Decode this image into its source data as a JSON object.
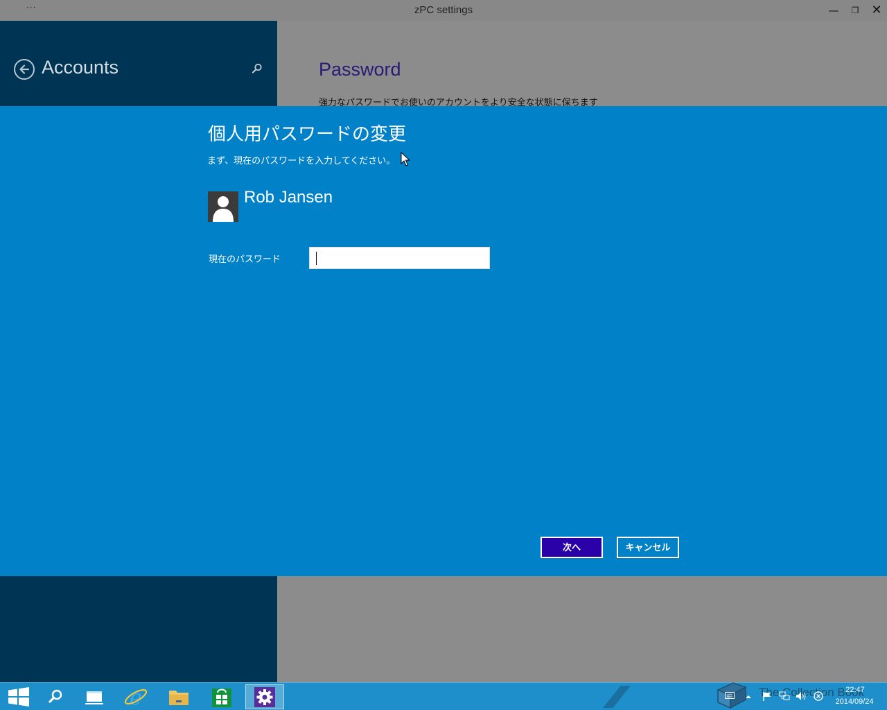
{
  "window": {
    "title": "zPC settings",
    "menu_dots": "···",
    "minimize_glyph": "—",
    "maximize_glyph": "❐",
    "close_glyph": "✕"
  },
  "left_pane": {
    "heading": "Accounts",
    "icons": [
      "back-arrow-icon",
      "search-icon"
    ]
  },
  "right_pane": {
    "heading": "Password",
    "description": "強力なパスワードでお使いのアカウントをより安全な状態に保ちます"
  },
  "dialog": {
    "title": "個人用パスワードの変更",
    "subtitle": "まず、現在のパスワードを入力してください。",
    "user_name": "Rob Jansen",
    "password_label": "現在のパスワード",
    "password_value": "",
    "next_button": "次へ",
    "cancel_button": "キャンセル"
  },
  "taskbar": {
    "apps": [
      "start-icon",
      "search-icon",
      "task-view-icon",
      "internet-explorer-icon",
      "file-explorer-icon",
      "store-icon",
      "settings-icon"
    ],
    "active_app": "settings-icon",
    "watermark": "The Collection Book",
    "clock_time": "22:47",
    "clock_date": "2014/09/24"
  },
  "colors": {
    "left_pane": "#003454",
    "dialog": "#0081c8",
    "next_button": "#2a00a8",
    "right_heading": "#2a1a78",
    "taskbar": "#1e8fca"
  }
}
